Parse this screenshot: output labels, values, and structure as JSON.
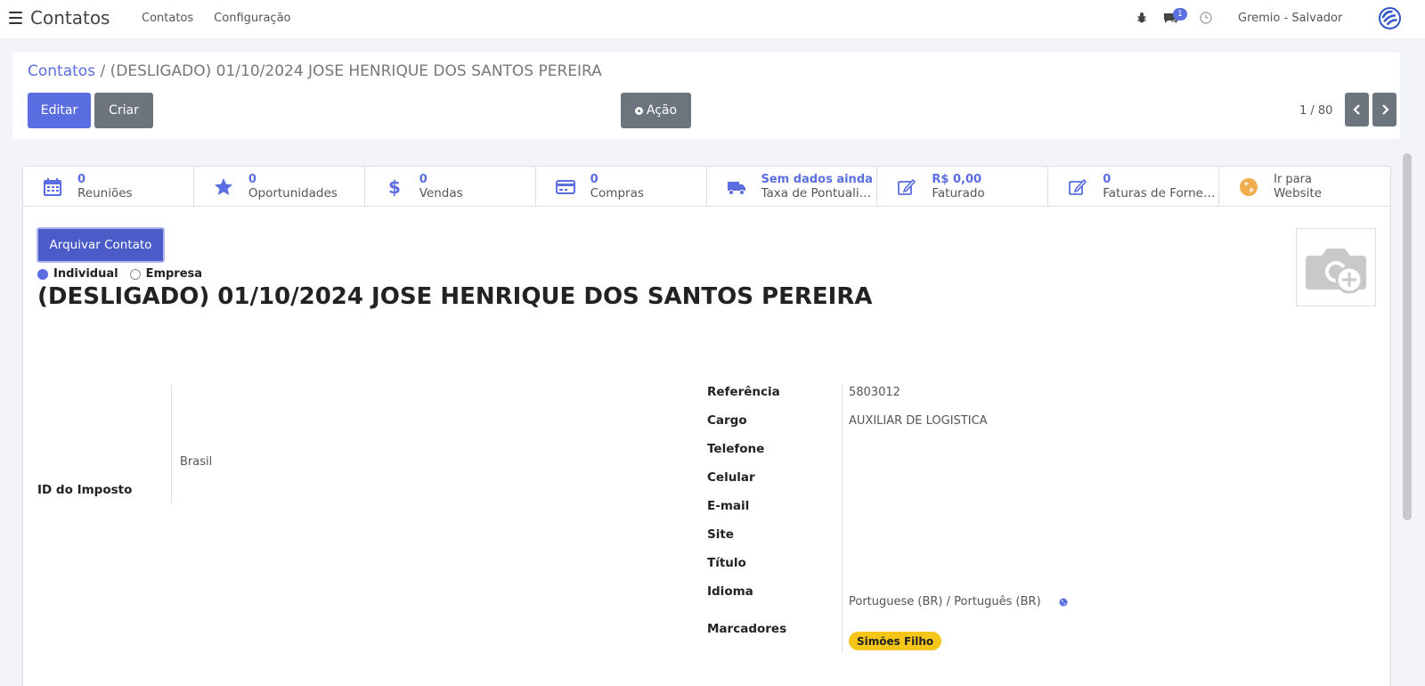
{
  "navbar": {
    "app_title": "Contatos",
    "menu": [
      "Contatos",
      "Configuração"
    ],
    "chat_badge": "1",
    "company": "Gremio - Salvador",
    "icons": [
      "bug-icon",
      "chat-icon",
      "clock-icon"
    ]
  },
  "breadcrumb": {
    "parent": "Contatos",
    "separator": " / ",
    "current": "(DESLIGADO) 01/10/2024 JOSE HENRIQUE DOS SANTOS PEREIRA"
  },
  "toolbar": {
    "edit_label": "Editar",
    "create_label": "Criar",
    "action_label": "Ação"
  },
  "pager": {
    "value": "1 / 80"
  },
  "stat_buttons": [
    {
      "value": "0",
      "label": "Reuniões",
      "icon": "calendar-icon"
    },
    {
      "value": "0",
      "label": "Oportunidades",
      "icon": "star-icon"
    },
    {
      "value": "0",
      "label": "Vendas",
      "icon": "dollar-icon"
    },
    {
      "value": "0",
      "label": "Compras",
      "icon": "credit-card-icon"
    },
    {
      "value": "Sem dados ainda",
      "label": "Taxa de Pontualidade",
      "icon": "truck-icon"
    },
    {
      "value": "R$ 0,00",
      "label": "Faturado",
      "icon": "edit-icon"
    },
    {
      "value": "0",
      "label": "Faturas de Fornecedores",
      "icon": "edit-icon"
    },
    {
      "value": "Ir para",
      "label": "Website",
      "icon": "globe-icon"
    }
  ],
  "form": {
    "archive_label": "Arquivar Contato",
    "type_options": [
      "Individual",
      "Empresa"
    ],
    "type_selected": "Individual",
    "name": "(DESLIGADO) 01/10/2024 JOSE HENRIQUE DOS SANTOS PEREIRA",
    "left": {
      "tax_id_label": "ID do Imposto",
      "country": "Brasil"
    },
    "right": {
      "reference_label": "Referência",
      "reference_value": "5803012",
      "job_label": "Cargo",
      "job_value": "AUXILIAR DE LOGISTICA",
      "phone_label": "Telefone",
      "mobile_label": "Celular",
      "email_label": "E-mail",
      "site_label": "Site",
      "title_label": "Título",
      "language_label": "Idioma",
      "language_value": "Portuguese (BR) / Português (BR)",
      "tags_label": "Marcadores",
      "tag_value": "Simões Filho"
    }
  },
  "colors": {
    "primary": "#5b6ee1",
    "secondary": "#6c757d",
    "tag": "#f5c518",
    "website_icon": "#f0ad4e"
  }
}
